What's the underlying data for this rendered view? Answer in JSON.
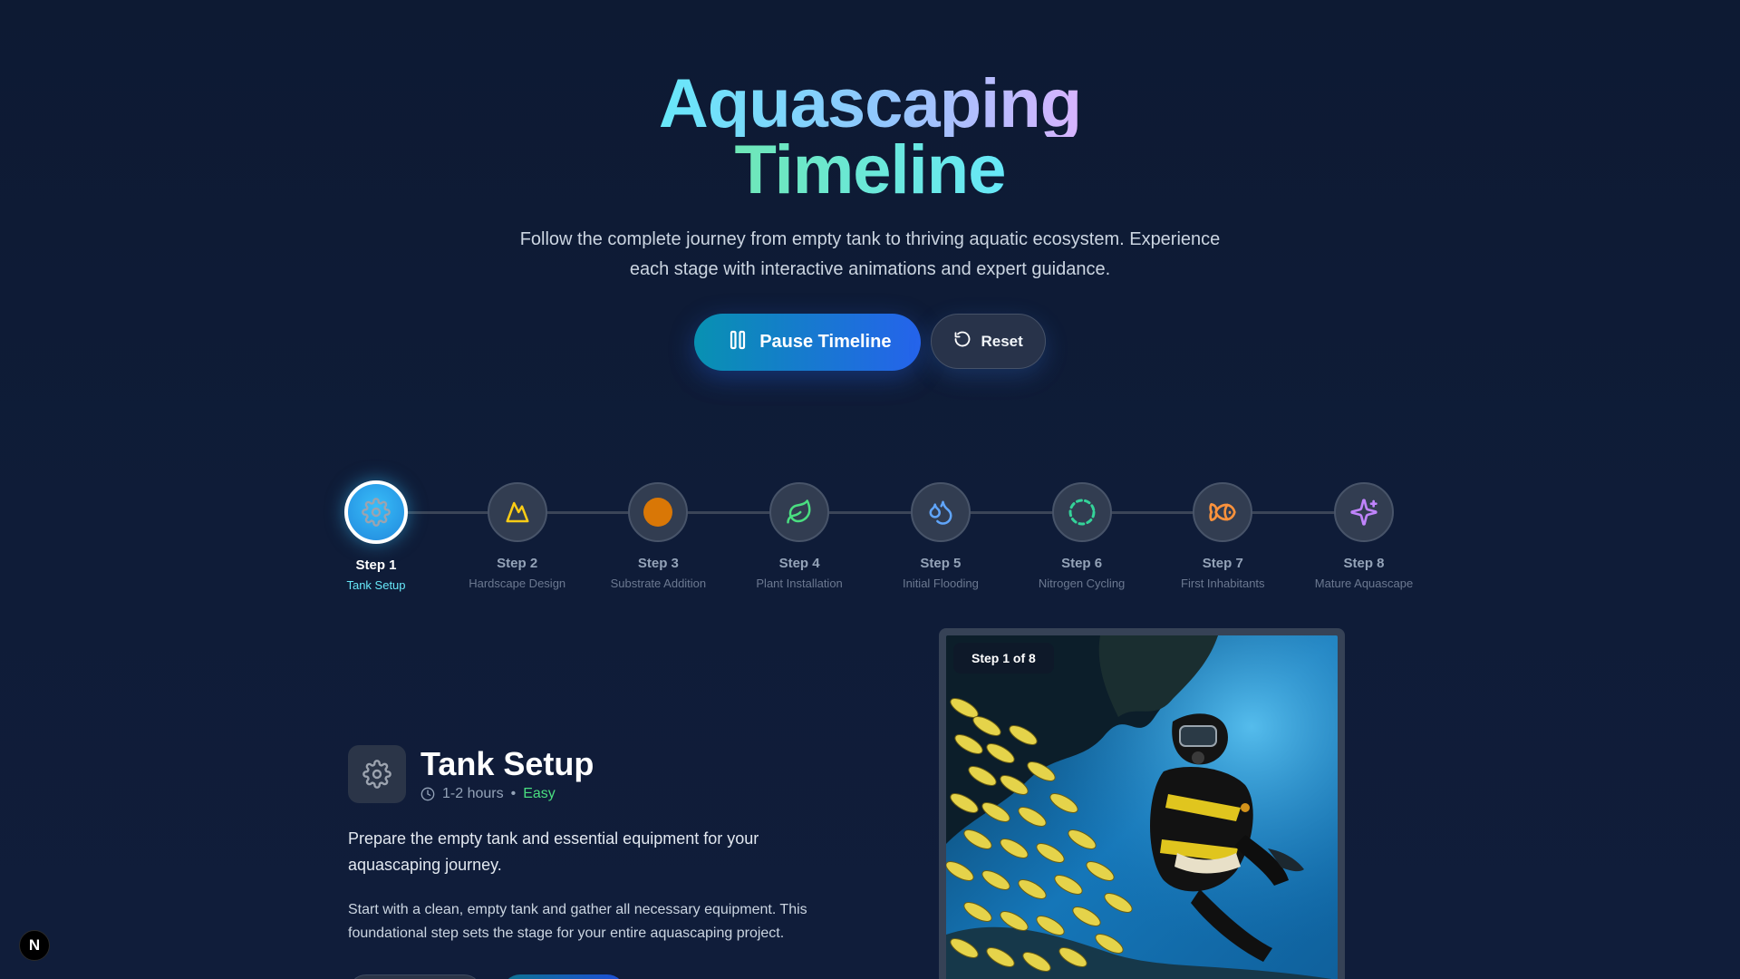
{
  "hero": {
    "title_line1": "Aquascaping",
    "title_line2": "Timeline",
    "subtitle": "Follow the complete journey from empty tank to thriving aquatic ecosystem. Experience each stage with interactive animations and expert guidance.",
    "pause_label": "Pause Timeline",
    "reset_label": "Reset"
  },
  "timeline": {
    "active_index": 0,
    "steps": [
      {
        "label": "Step 1",
        "name": "Tank Setup",
        "icon": "gear-icon",
        "color": "#9ca3af"
      },
      {
        "label": "Step 2",
        "name": "Hardscape Design",
        "icon": "mountain-icon",
        "color": "#facc15"
      },
      {
        "label": "Step 3",
        "name": "Substrate Addition",
        "icon": "substrate-circle-icon",
        "color": "#d97706"
      },
      {
        "label": "Step 4",
        "name": "Plant Installation",
        "icon": "leaf-icon",
        "color": "#4ade80"
      },
      {
        "label": "Step 5",
        "name": "Initial Flooding",
        "icon": "droplets-icon",
        "color": "#60a5fa"
      },
      {
        "label": "Step 6",
        "name": "Nitrogen Cycling",
        "icon": "cycle-dashed-circle-icon",
        "color": "#34d399"
      },
      {
        "label": "Step 7",
        "name": "First Inhabitants",
        "icon": "fish-icon",
        "color": "#fb923c"
      },
      {
        "label": "Step 8",
        "name": "Mature Aquascape",
        "icon": "sparkles-icon",
        "color": "#c084fc"
      }
    ]
  },
  "detail": {
    "icon": "gear-icon",
    "title": "Tank Setup",
    "duration": "1-2 hours",
    "separator": "•",
    "difficulty": "Easy",
    "lead": "Prepare the empty tank and essential equipment for your aquascaping journey.",
    "body": "Start with a clean, empty tank and gather all necessary equipment. This foundational step sets the stage for your entire aquascaping project."
  },
  "media": {
    "badge": "Step 1 of 8",
    "image": "underwater-diver-with-fish-school"
  },
  "corner_badge": "N",
  "colors": {
    "accent_cyan": "#67e8f9",
    "accent_blue": "#2563eb",
    "easy_green": "#4ade80"
  }
}
